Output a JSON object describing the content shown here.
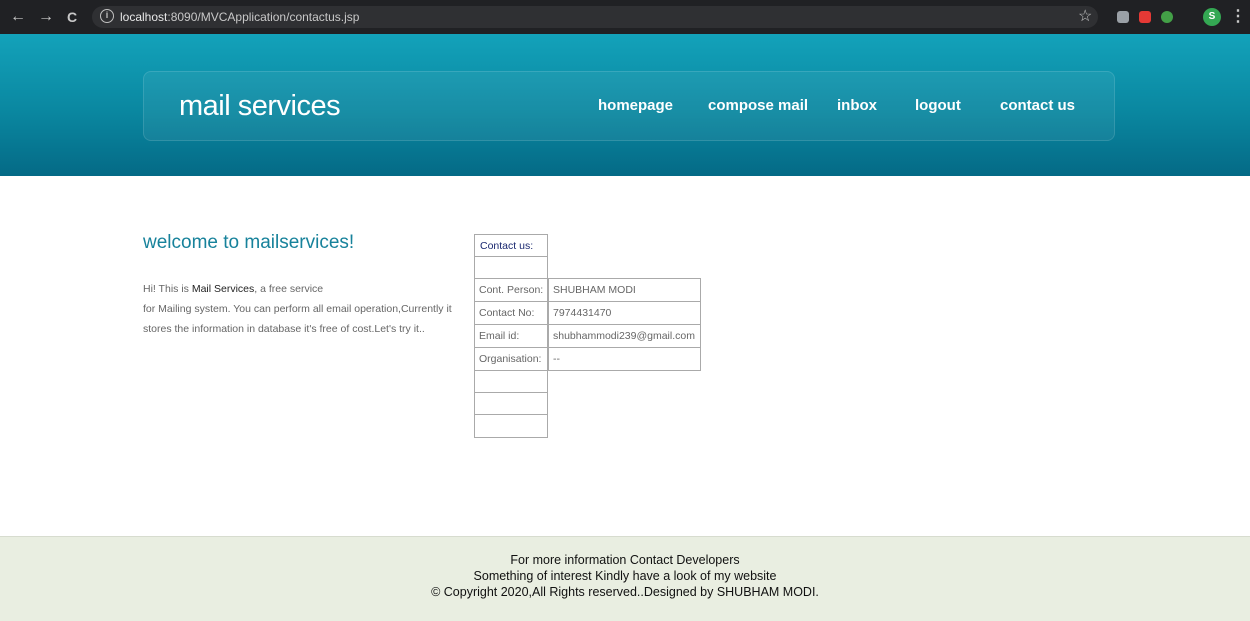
{
  "browser": {
    "back_glyph": "←",
    "forward_glyph": "→",
    "reload_glyph": "C",
    "info_glyph": "i",
    "url_host": "localhost",
    "url_rest": ":8090/MVCApplication/contactus.jsp",
    "bookmark_glyph": "☆",
    "profile_initial": "S",
    "menu_glyph": "⋮",
    "extension_colors": [
      "#9aa0a6",
      "#e53935",
      "#43a047"
    ]
  },
  "header": {
    "brand": "mail services",
    "nav": [
      "homepage",
      "compose mail",
      "inbox",
      "logout",
      "contact us"
    ]
  },
  "main": {
    "welcome": "welcome to mailservices!",
    "intro_prefix": "Hi! This is ",
    "intro_bold": "Mail Services",
    "intro_suffix": ", a free service",
    "intro_line2": "for Mailing system. You can perform all email operation,Currently it",
    "intro_line3": "stores the information in database it's free of cost.Let's try it.."
  },
  "contact": {
    "title": "Contact us:",
    "rows": [
      {
        "label": "Cont. Person:",
        "value": "SHUBHAM MODI"
      },
      {
        "label": "Contact No:",
        "value": "7974431470"
      },
      {
        "label": "Email id:",
        "value": "shubhammodi239@gmail.com"
      },
      {
        "label": "Organisation:",
        "value": "--"
      }
    ]
  },
  "footer": {
    "line1": "For more information Contact Developers",
    "line2": "Something of interest Kindly have a look of my website",
    "line3": "© Copyright 2020,All Rights reserved..Designed by SHUBHAM MODI."
  }
}
